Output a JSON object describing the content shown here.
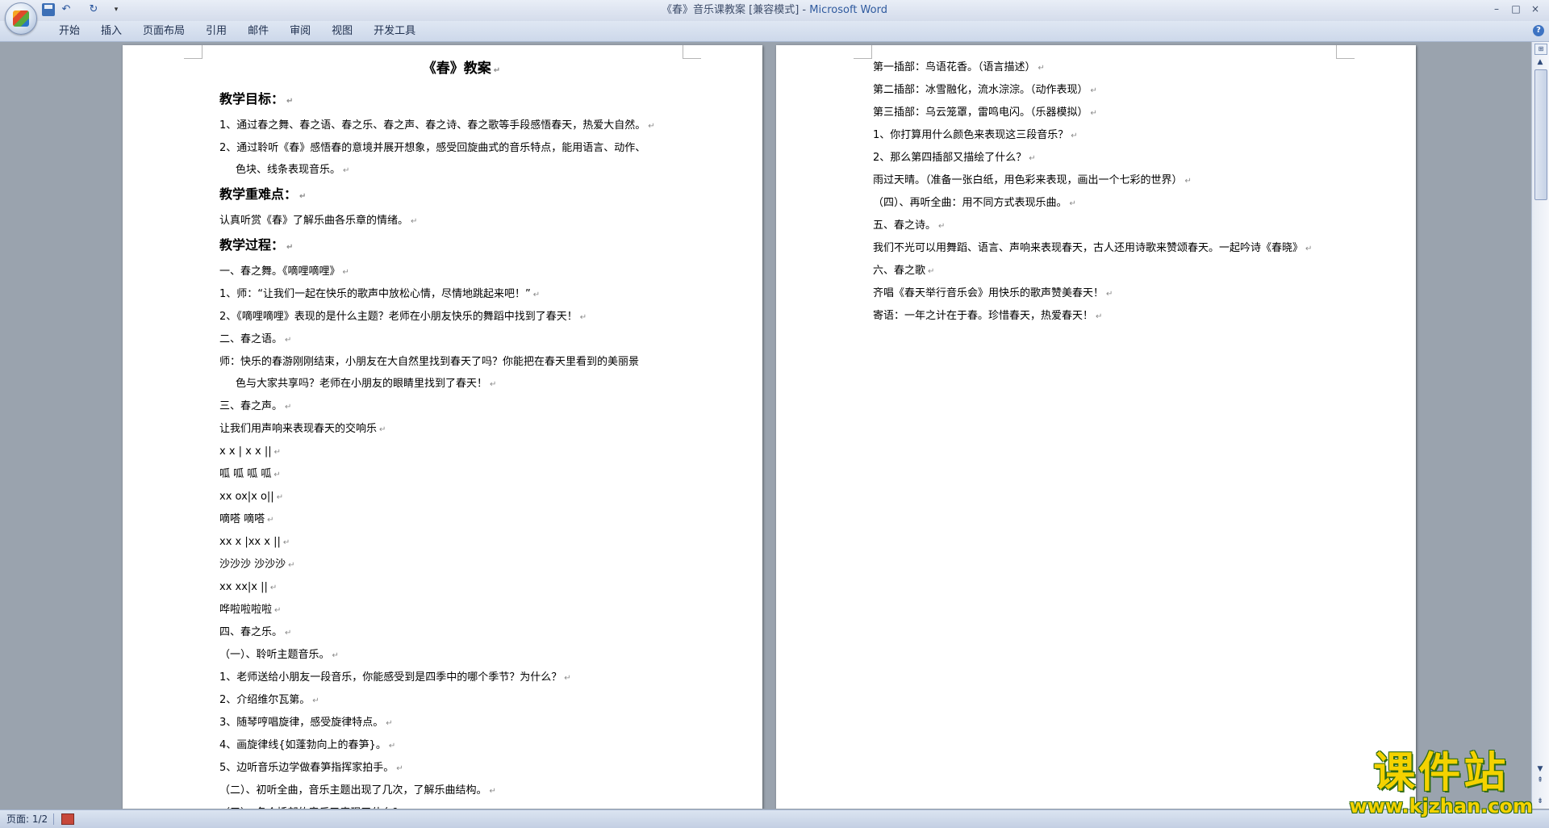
{
  "window": {
    "title_doc": "《春》音乐课教案 [兼容模式]",
    "title_sep": " - ",
    "title_app": "Microsoft Word",
    "min_glyph": "–",
    "max_glyph": "□",
    "close_glyph": "×"
  },
  "quick_access": {
    "undo_glyph": "↶",
    "redo_glyph": "↻",
    "customize_glyph": "▾"
  },
  "ribbon": {
    "tabs": [
      "开始",
      "插入",
      "页面布局",
      "引用",
      "邮件",
      "审阅",
      "视图",
      "开发工具"
    ],
    "help_glyph": "?"
  },
  "page1": {
    "title": "《春》教案",
    "lines": [
      {
        "t": "教学目标：",
        "k": "h"
      },
      {
        "t": "1、通过春之舞、春之语、春之乐、春之声、春之诗、春之歌等手段感悟春天，热爱大自然。",
        "k": "p"
      },
      {
        "t": "2、通过聆听《春》感悟春的意境并展开想象，感受回旋曲式的音乐特点，能用语言、动作、",
        "k": "p",
        "nm": true
      },
      {
        "t": "色块、线条表现音乐。",
        "k": "c"
      },
      {
        "t": "教学重难点：",
        "k": "h"
      },
      {
        "t": "认真听赏《春》了解乐曲各乐章的情绪。",
        "k": "p"
      },
      {
        "t": "教学过程：",
        "k": "h"
      },
      {
        "t": "一、春之舞。《嘀哩嘀哩》",
        "k": "p"
      },
      {
        "t": "1、师：“让我们一起在快乐的歌声中放松心情，尽情地跳起来吧！”",
        "k": "p"
      },
      {
        "t": "2、《嘀哩嘀哩》表现的是什么主题？老师在小朋友快乐的舞蹈中找到了春天！",
        "k": "p"
      },
      {
        "t": "二、春之语。",
        "k": "p"
      },
      {
        "t": "师：快乐的春游刚刚结束，小朋友在大自然里找到春天了吗？你能把在春天里看到的美丽景",
        "k": "p",
        "nm": true
      },
      {
        "t": "色与大家共享吗？老师在小朋友的眼睛里找到了春天！",
        "k": "c"
      },
      {
        "t": "三、春之声。",
        "k": "p"
      },
      {
        "t": "让我们用声响来表现春天的交响乐",
        "k": "p"
      },
      {
        "t": "x    x | x    x ||",
        "k": "p"
      },
      {
        "t": "呱  呱    呱    呱",
        "k": "p"
      },
      {
        "t": "xx ox|x o||",
        "k": "p"
      },
      {
        "t": "嘀嗒  嘀嗒",
        "k": "p"
      },
      {
        "t": "xx x |xx x ||",
        "k": "p"
      },
      {
        "t": "沙沙沙    沙沙沙",
        "k": "p"
      },
      {
        "t": "xx xx|x        ||",
        "k": "p"
      },
      {
        "t": "哗啦啦啦啦",
        "k": "p"
      },
      {
        "t": "四、春之乐。",
        "k": "p"
      },
      {
        "t": "（一）、聆听主题音乐。",
        "k": "p"
      },
      {
        "t": "1、老师送给小朋友一段音乐，你能感受到是四季中的哪个季节？为什么？",
        "k": "p"
      },
      {
        "t": "2、介绍维尔瓦第。",
        "k": "p"
      },
      {
        "t": "3、随琴哼唱旋律，感受旋律特点。",
        "k": "p"
      },
      {
        "t": "4、画旋律线{如蓬勃向上的春笋}。",
        "k": "p"
      },
      {
        "t": "5、边听音乐边学做春笋指挥家拍手。",
        "k": "p"
      },
      {
        "t": "（二）、初听全曲，音乐主题出现了几次，了解乐曲结构。",
        "k": "p"
      },
      {
        "t": "（三）、各个插部的音乐又表现了什么？",
        "k": "p"
      }
    ]
  },
  "page2": {
    "lines": [
      {
        "t": "第一插部：鸟语花香。（语言描述）",
        "k": "p"
      },
      {
        "t": "第二插部：冰雪融化，流水淙淙。（动作表现）",
        "k": "p"
      },
      {
        "t": "第三插部：乌云笼罩，雷鸣电闪。（乐器模拟）",
        "k": "p"
      },
      {
        "t": "1、你打算用什么颜色来表现这三段音乐？",
        "k": "p"
      },
      {
        "t": "2、那么第四插部又描绘了什么？",
        "k": "p"
      },
      {
        "t": "雨过天晴。（准备一张白纸，用色彩来表现，画出一个七彩的世界）",
        "k": "p"
      },
      {
        "t": "（四）、再听全曲：用不同方式表现乐曲。",
        "k": "p"
      },
      {
        "t": "五、春之诗。",
        "k": "p"
      },
      {
        "t": "我们不光可以用舞蹈、语言、声响来表现春天，古人还用诗歌来赞颂春天。一起吟诗《春晓》",
        "k": "p"
      },
      {
        "t": "六、春之歌",
        "k": "p"
      },
      {
        "t": "齐唱《春天举行音乐会》用快乐的歌声赞美春天！",
        "k": "p"
      },
      {
        "t": "寄语：一年之计在于春。珍惜春天，热爱春天！",
        "k": "p"
      }
    ]
  },
  "paragraph_mark": "↵",
  "status": {
    "page": "页面: 1/2"
  },
  "scrollbar": {
    "ruler_glyph": "⊞",
    "up_glyph": "▲",
    "down_glyph": "▼",
    "prev_glyph": "⇞",
    "next_glyph": "⇟"
  },
  "watermark": {
    "text": "课件站",
    "url": "www.kjzhan.com"
  }
}
